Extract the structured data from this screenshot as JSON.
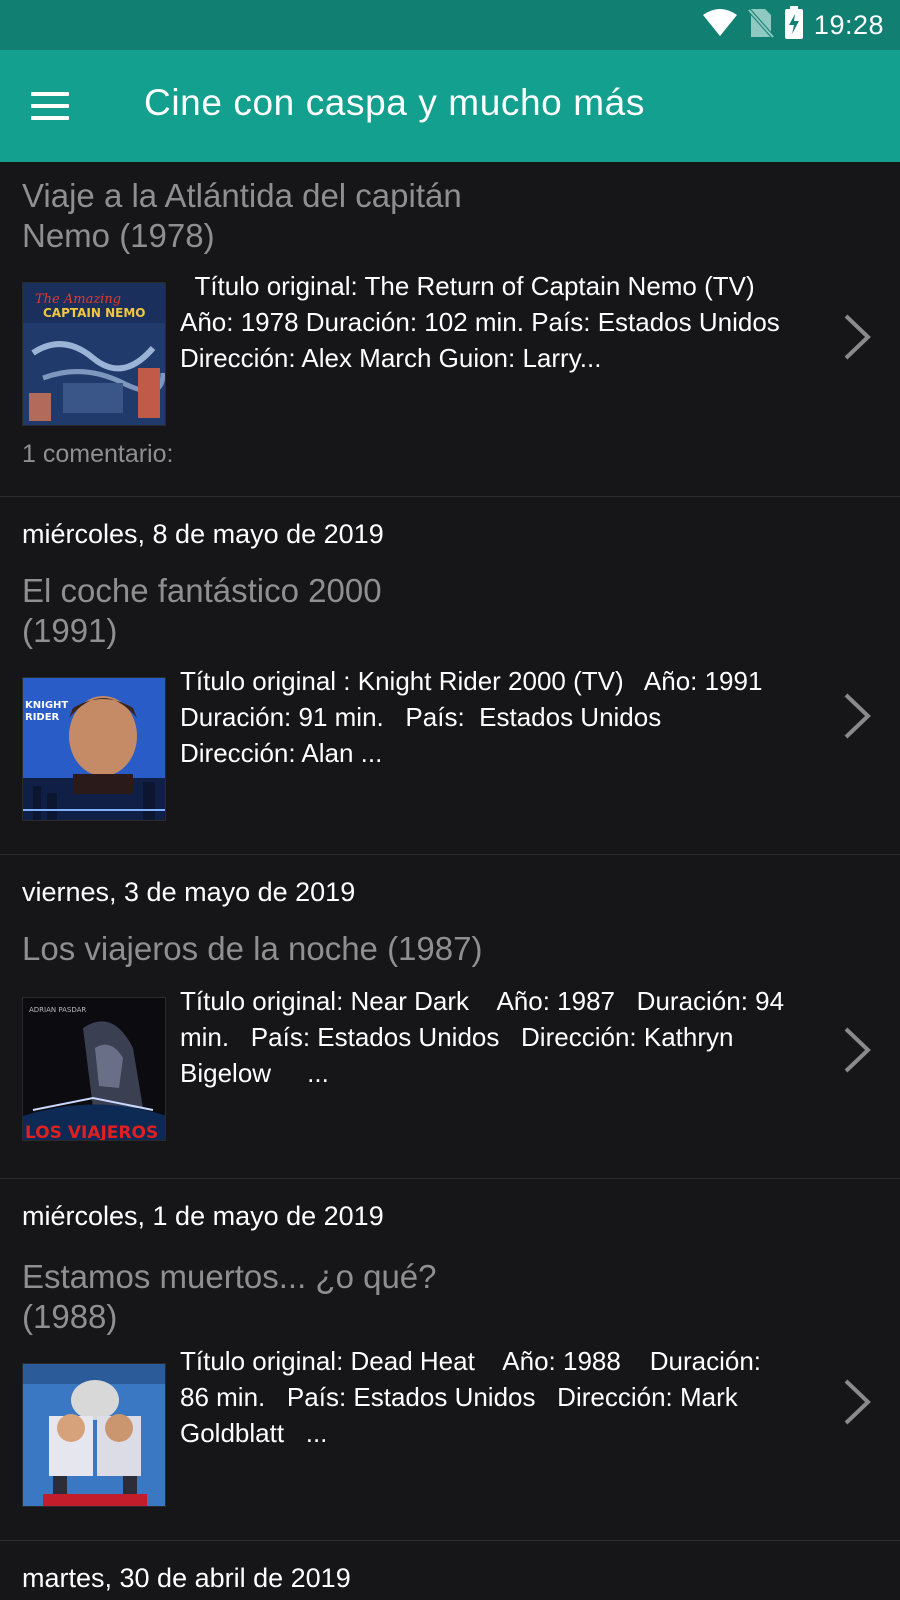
{
  "status_bar": {
    "time": "19:28",
    "icons": [
      "wifi-icon",
      "no-sim-icon",
      "battery-charging-icon"
    ]
  },
  "app_bar": {
    "title": "Cine con caspa y mucho más",
    "menu_icon": "hamburger-menu-icon"
  },
  "colors": {
    "status_bar": "#117f72",
    "app_bar": "#13a08f",
    "background": "#161618",
    "title_text": "#8f8f8f",
    "divider": "#2c2c2e"
  },
  "posts": [
    {
      "date": "",
      "title": "Viaje a la Atlántida del capitán\nNemo (1978)",
      "description": "  Título original: The Return of Captain Nemo (TV)\nAño: 1978 Duración: 102 min. País: Estados Unidos\nDirección: Alex March Guion: Larry...",
      "comments": "1 comentario:",
      "thumbnail": "poster-captain-nemo"
    },
    {
      "date": "miércoles, 8 de mayo de 2019",
      "title": "El coche fantástico 2000\n(1991)",
      "description": "Título original : Knight Rider 2000 (TV)   Año: 1991\nDuración: 91 min.   País:  Estados Unidos\nDirección: Alan ...",
      "comments": "",
      "thumbnail": "poster-knight-rider"
    },
    {
      "date": "viernes, 3 de mayo de 2019",
      "title": "Los viajeros de la noche (1987)",
      "description": "Título original: Near Dark    Año: 1987   Duración: 94\nmin.   País: Estados Unidos   Dirección: Kathryn\nBigelow     ...",
      "comments": "",
      "thumbnail": "poster-near-dark"
    },
    {
      "date": "miércoles, 1 de mayo de 2019",
      "title": "Estamos muertos... ¿o qué?\n(1988)",
      "description": "Título original: Dead Heat    Año: 1988    Duración:\n86 min.   País: Estados Unidos   Dirección: Mark\nGoldblatt   ...",
      "comments": "",
      "thumbnail": "poster-dead-heat"
    },
    {
      "date": "martes, 30 de abril de 2019",
      "title": "",
      "description": "",
      "comments": "",
      "thumbnail": ""
    }
  ]
}
